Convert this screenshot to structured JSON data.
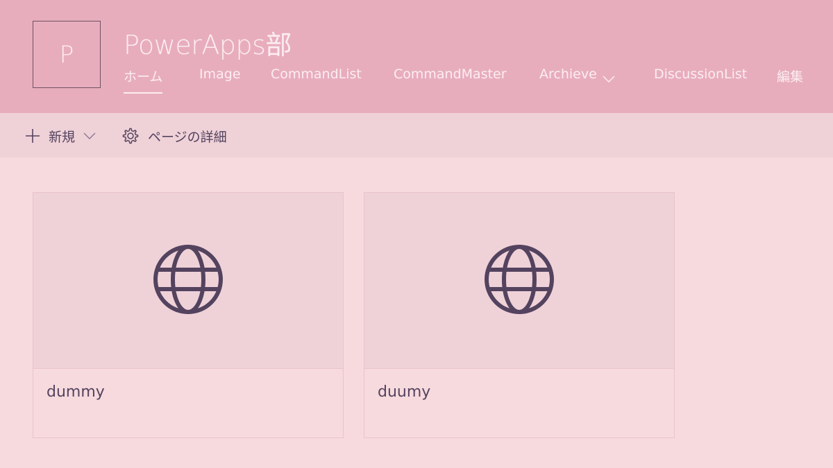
{
  "site": {
    "logo_letter": "P",
    "title": "PowerApps部"
  },
  "nav": {
    "items": [
      {
        "label": "ホーム",
        "active": true
      },
      {
        "label": "Image"
      },
      {
        "label": "CommandList"
      },
      {
        "label": "CommandMaster"
      },
      {
        "label": "Archieve",
        "has_dropdown": true
      },
      {
        "label": "DiscussionList"
      },
      {
        "label": "編集"
      }
    ]
  },
  "commandbar": {
    "new_label": "新規",
    "page_details_label": "ページの詳細"
  },
  "cards": [
    {
      "title": "dummy",
      "icon": "globe-icon"
    },
    {
      "title": "duumy",
      "icon": "globe-icon"
    }
  ],
  "colors": {
    "header": "#e8adbd",
    "commandbar": "#efd2d8",
    "page": "#f7dade",
    "text": "#54435f",
    "header_text": "#fbeef1"
  }
}
